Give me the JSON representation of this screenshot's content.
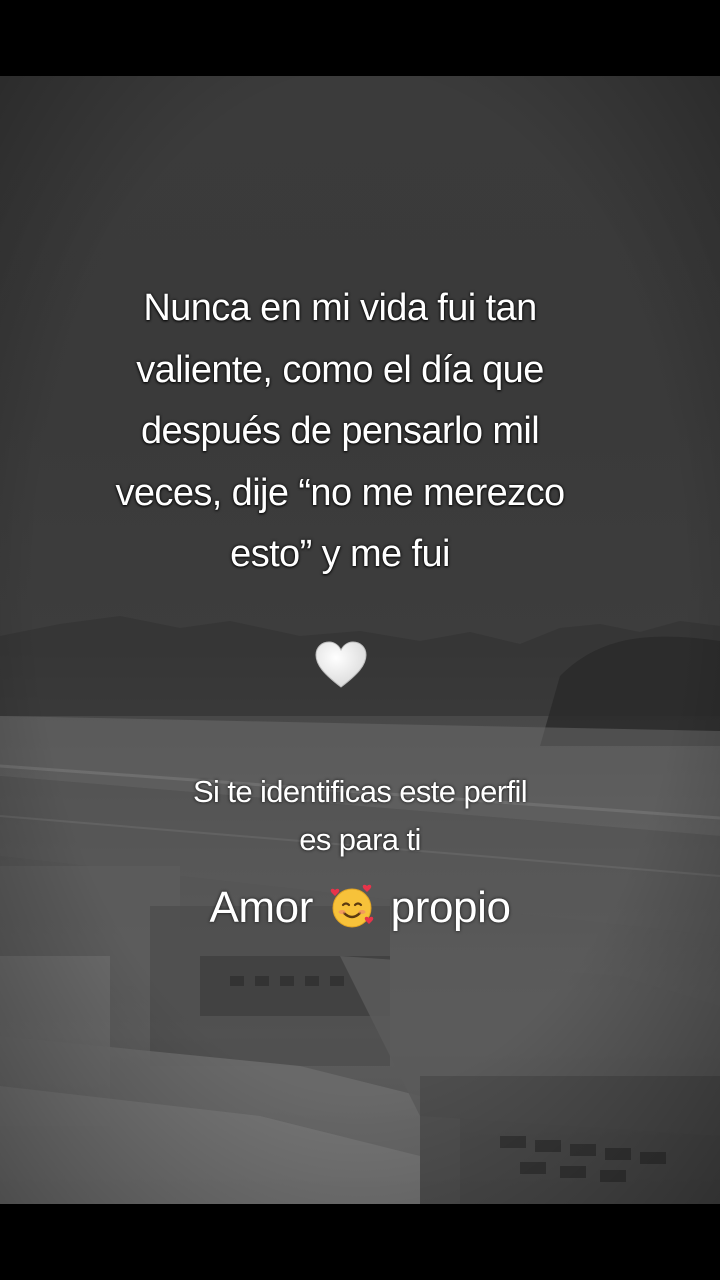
{
  "overlay": {
    "quote_lines": [
      "Nunca en mi vida fui tan",
      "valiente, como el día que",
      "después de pensarlo mil",
      "veces, dije “no me merezco",
      "esto” y me fui"
    ],
    "heart_emoji": "white-heart-icon",
    "subtitle_line1": "Si te identificas este perfil",
    "subtitle_line2": "es para ti",
    "title_before": "Amor",
    "title_emoji": "smiling-face-with-hearts-icon",
    "title_after": "propio"
  },
  "colors": {
    "text": "#ffffff",
    "letterbox": "#000000",
    "photo_tone": "#4a4a4a"
  }
}
